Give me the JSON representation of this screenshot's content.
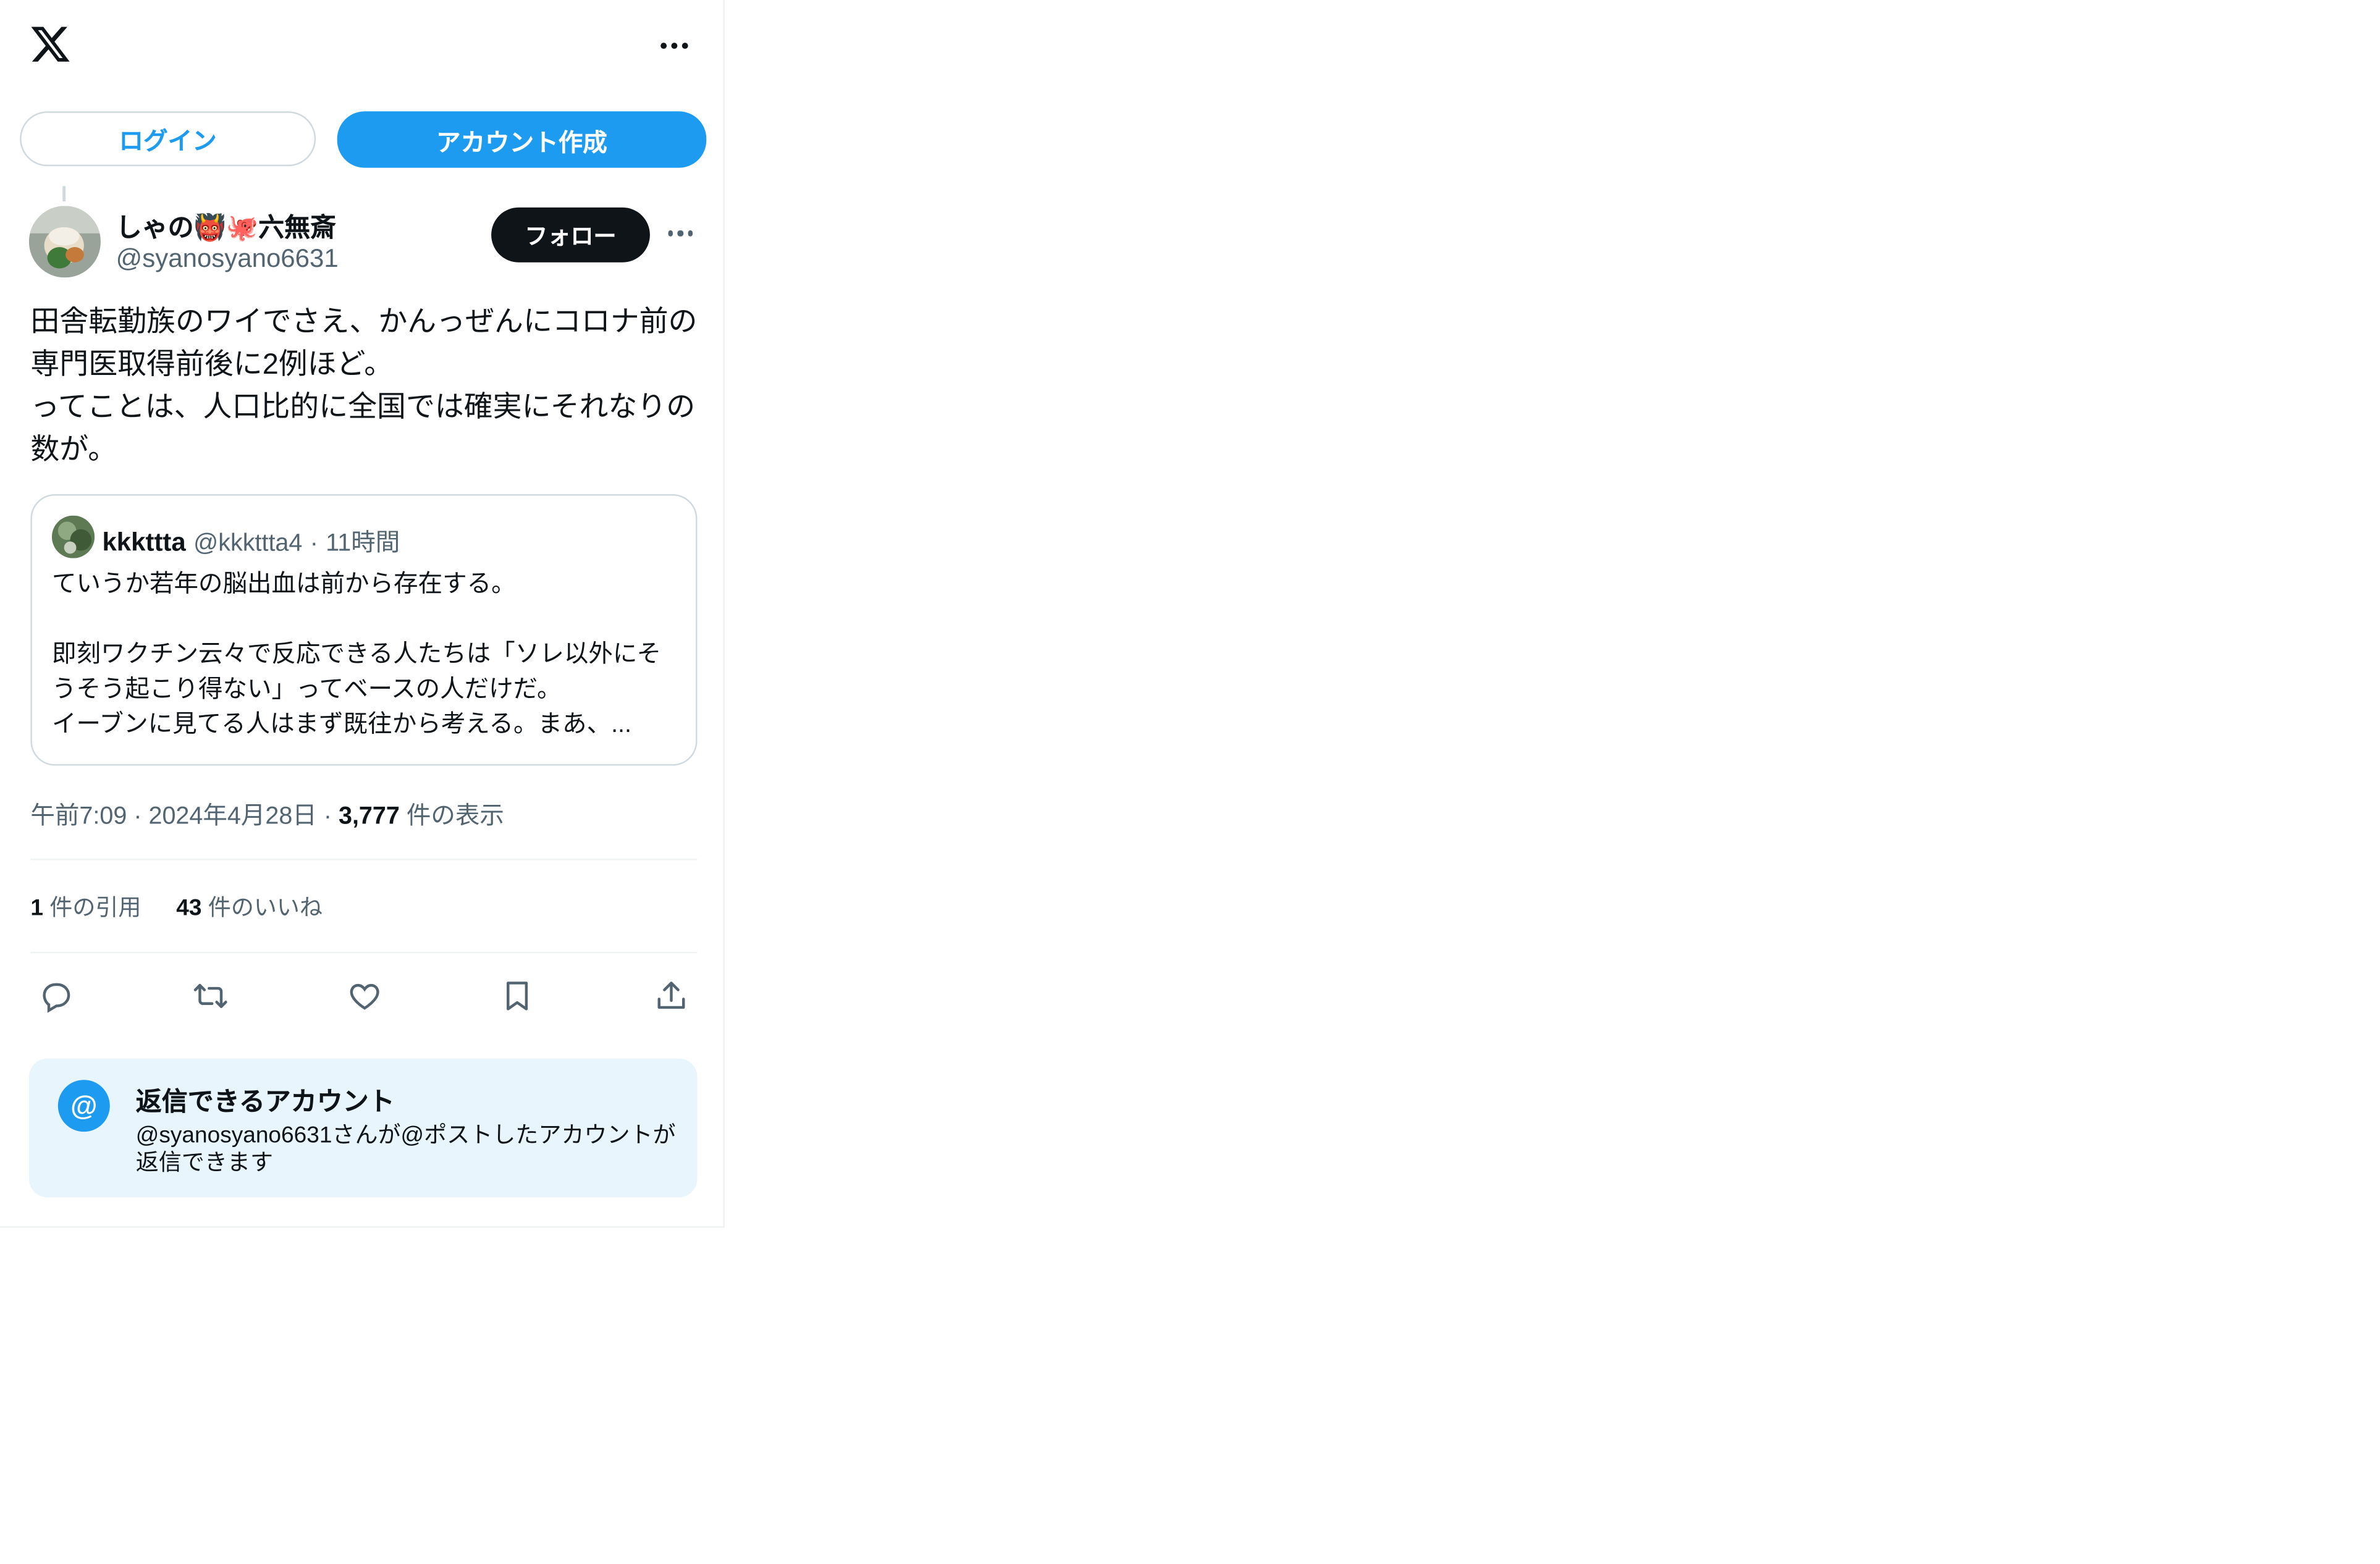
{
  "header": {
    "logo_icon": "x-logo-icon",
    "more_icon": "more-horizontal-icon"
  },
  "auth": {
    "login_label": "ログイン",
    "signup_label": "アカウント作成"
  },
  "author": {
    "name": "しゃの👹🐙六無斎",
    "handle": "@syanosyano6631",
    "follow_label": "フォロー"
  },
  "post": {
    "text": "田舎転勤族のワイでさえ、かんっぜんにコロナ前の専門医取得前後に2例ほど。\nってことは、人口比的に全国では確実にそれなりの数が。"
  },
  "quote": {
    "name": "kkkttta",
    "handle": "@kkkttta4",
    "separator": "·",
    "time": "11時間",
    "text": "ていうか若年の脳出血は前から存在する。\n\n即刻ワクチン云々で反応できる人たちは「ソレ以外にそうそう起こり得ない」ってベースの人だけだ。\nイーブンに見てる人はまず既往から考える。まあ、..."
  },
  "meta": {
    "time": "午前7:09",
    "sep1": "·",
    "date": "2024年4月28日",
    "sep2": "·",
    "views_count": "3,777",
    "views_label": "件の表示"
  },
  "stats": {
    "quotes_count": "1",
    "quotes_label": "件の引用",
    "likes_count": "43",
    "likes_label": "件のいいね"
  },
  "reply_settings": {
    "icon": "@",
    "title": "返信できるアカウント",
    "description": "@syanosyano6631さんが@ポストしたアカウントが返信できます"
  },
  "colors": {
    "accent": "#1d9bf0",
    "text": "#0f1419",
    "muted": "#536471",
    "reply_bg": "#e8f5fd"
  }
}
